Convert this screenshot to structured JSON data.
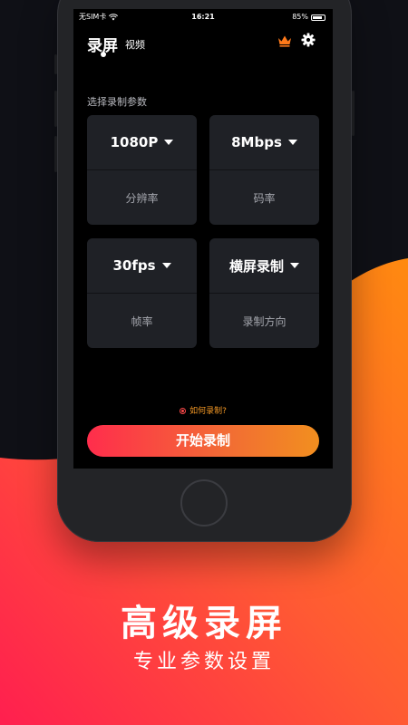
{
  "status_bar": {
    "carrier": "无SIM卡",
    "time": "16:21",
    "battery": "85%"
  },
  "header": {
    "tab_record": "录屏",
    "tab_video": "视频"
  },
  "section_label": "选择录制参数",
  "params": [
    {
      "value": "1080P",
      "label": "分辨率"
    },
    {
      "value": "8Mbps",
      "label": "码率"
    },
    {
      "value": "30fps",
      "label": "帧率"
    },
    {
      "value": "横屏录制",
      "label": "录制方向"
    }
  ],
  "help_link": "如何录制?",
  "start_button": "开始录制",
  "promo": {
    "headline": "高级录屏",
    "subline": "专业参数设置"
  },
  "colors": {
    "accent_gradient_start": "#ff2d4c",
    "accent_gradient_end": "#f28f1f",
    "crown": "#ff7a1a",
    "help_text": "#f39825"
  }
}
